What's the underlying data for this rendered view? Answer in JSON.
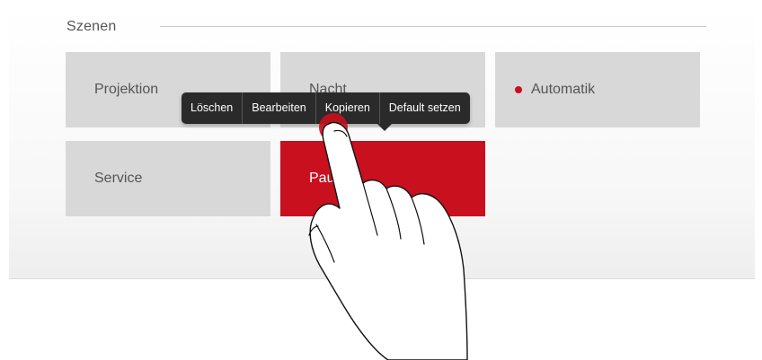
{
  "section": {
    "title": "Szenen"
  },
  "tiles": [
    {
      "label": "Projektion",
      "active": false,
      "indicator": false
    },
    {
      "label": "Nacht",
      "active": false,
      "indicator": false
    },
    {
      "label": "Automatik",
      "active": false,
      "indicator": true
    },
    {
      "label": "Service",
      "active": false,
      "indicator": false
    },
    {
      "label": "Pause",
      "active": true,
      "indicator": false
    }
  ],
  "context_menu": {
    "items": [
      "Löschen",
      "Bearbeiten",
      "Kopieren",
      "Default setzen"
    ]
  },
  "colors": {
    "accent": "#c8101e",
    "tile_bg": "#d8d8d8",
    "menu_bg": "#2a2a2a"
  },
  "icons": {
    "hand": "hand-tap-icon",
    "touch": "touch-point-icon",
    "status_dot": "status-dot-icon"
  }
}
